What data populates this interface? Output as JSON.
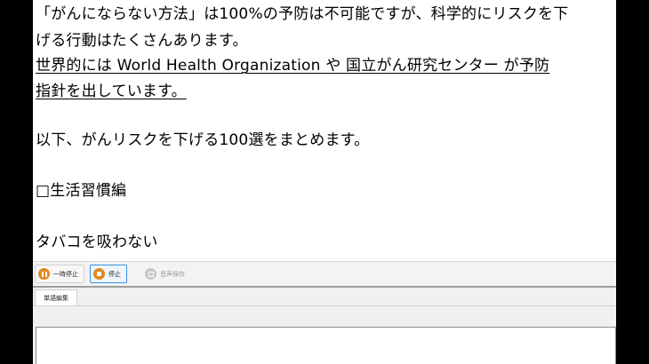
{
  "document": {
    "lines": [
      "「がんにならない方法」は100%の予防は不可能ですが、科学的にリスクを下",
      "げる行動はたくさんあります。",
      "世界的には World Health Organization や 国立がん研究センター が予防",
      "指針を出しています。",
      "以下、がんリスクを下げる100選をまとめます。",
      "□生活習慣編",
      "タバコを吸わない"
    ]
  },
  "toolbar": {
    "pause_label": "一時停止",
    "stop_label": "停止",
    "save_audio_label": "音声保存",
    "pause_icon": "pause-icon",
    "stop_icon": "stop-icon",
    "save_icon": "save-audio-icon"
  },
  "tabs": {
    "word_edit_label": "単語編集"
  },
  "colors": {
    "accent_orange": "#e08a1e",
    "active_border": "#3d8ee0"
  }
}
